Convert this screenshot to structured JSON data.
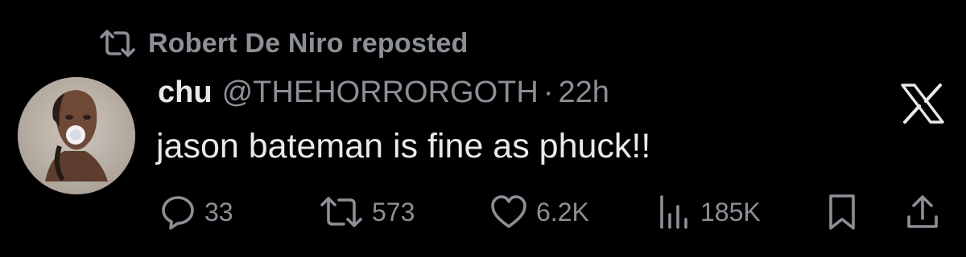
{
  "repost": {
    "icon": "repost-icon",
    "text": "Robert De Niro reposted"
  },
  "post": {
    "display_name": "chu",
    "handle": "@THEHORRORGOTH",
    "separator": "·",
    "time": "22h",
    "text": "jason bateman is fine as phuck!!",
    "platform_icon": "x-logo-icon"
  },
  "actions": {
    "replies": "33",
    "reposts": "573",
    "likes": "6.2K",
    "views": "185K"
  },
  "colors": {
    "background": "#000000",
    "primary_text": "#e7e9ea",
    "secondary_text": "#8b9096"
  }
}
